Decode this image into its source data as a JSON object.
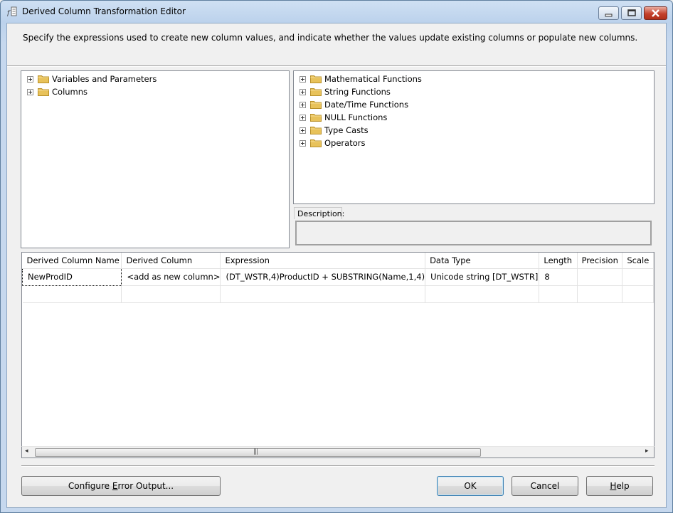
{
  "window": {
    "title": "Derived Column Transformation Editor"
  },
  "instructions": "Specify the expressions used to create new column values, and indicate whether the values update existing columns or populate new columns.",
  "left_tree": {
    "items": [
      {
        "label": "Variables and Parameters"
      },
      {
        "label": "Columns"
      }
    ]
  },
  "right_tree": {
    "items": [
      {
        "label": "Mathematical Functions"
      },
      {
        "label": "String Functions"
      },
      {
        "label": "Date/Time Functions"
      },
      {
        "label": "NULL Functions"
      },
      {
        "label": "Type Casts"
      },
      {
        "label": "Operators"
      }
    ]
  },
  "description": {
    "label": "Description:",
    "value": ""
  },
  "grid": {
    "headers": [
      "Derived Column Name",
      "Derived Column",
      "Expression",
      "Data Type",
      "Length",
      "Precision",
      "Scale"
    ],
    "rows": [
      [
        "NewProdID",
        "<add as new column>",
        "(DT_WSTR,4)ProductID + SUBSTRING(Name,1,4)",
        "Unicode string [DT_WSTR]",
        "8",
        "",
        ""
      ]
    ]
  },
  "scrollbar": {
    "left_arrow": "◂",
    "right_arrow": "▸",
    "grip": "|||"
  },
  "buttons": {
    "configure_pre": "Configure ",
    "configure_key": "E",
    "configure_post": "rror Output...",
    "ok": "OK",
    "cancel": "Cancel",
    "help_key": "H",
    "help_post": "elp"
  },
  "icons": {
    "folder_color": "#e8c25a",
    "title_icon": "derived-column-icon"
  }
}
